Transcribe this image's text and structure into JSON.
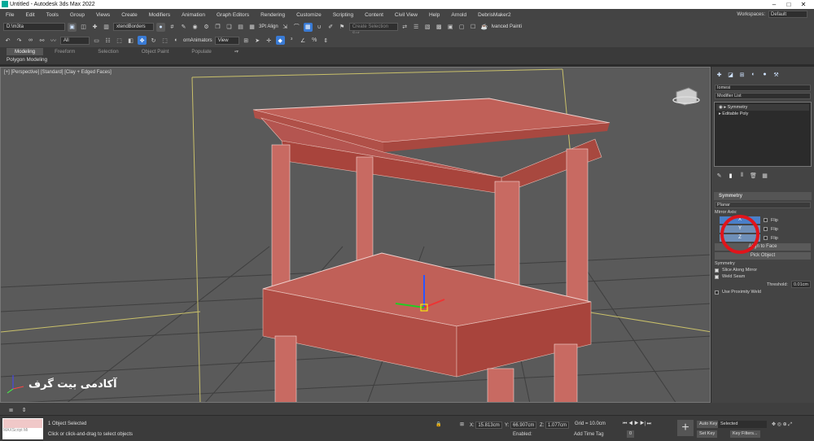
{
  "window": {
    "title": "Untitled - Autodesk 3ds Max 2022",
    "controls": [
      "–",
      "□",
      "✕"
    ]
  },
  "menu": [
    "File",
    "Edit",
    "Tools",
    "Group",
    "Views",
    "Create",
    "Modifiers",
    "Animation",
    "Graph Editors",
    "Rendering",
    "Customize",
    "Scripting",
    "Content",
    "Civil View",
    "Help",
    "Arnold",
    "DebrisMaker2"
  ],
  "workspaces": {
    "label": "Workspaces:",
    "value": "Default"
  },
  "toolbar1": {
    "path": "D:\\m3ta",
    "selection_label": "xtendBorders",
    "align": "3Pt Align",
    "snaps": "Create Selection Set",
    "advanced": "lvanced Painti"
  },
  "toolbar2": {
    "filter": "All",
    "animators": "ornAnimators",
    "view": "View"
  },
  "ribbon": {
    "tabs": [
      "Modeling",
      "Freeform",
      "Selection",
      "Object Paint",
      "Populate"
    ],
    "active": "Modeling",
    "sub": "Polygon Modeling"
  },
  "viewport": {
    "label": "[+] [Perspective] [Standard] [Clay + Edged Faces]",
    "watermark": "آکادمی بیت گرف"
  },
  "cmdpanel": {
    "object_name": "Iomesi",
    "modifier_list": "Modifier List",
    "stack": [
      "Symmetry",
      "Editable Poly"
    ],
    "rollout": "Symmetry",
    "mode": "Planar",
    "mirror_axis_label": "Mirror Axis:",
    "axes": [
      {
        "name": "X",
        "flip": "Flip"
      },
      {
        "name": "Y",
        "flip": "Flip"
      },
      {
        "name": "Z",
        "flip": "Flip"
      }
    ],
    "align_btn": "Align to Face",
    "pick_btn": "Pick Object",
    "sym_label": "Symmetry",
    "slice": "Slice Along Mirror",
    "weld": "Weld Seam",
    "threshold_label": "Threshold:",
    "threshold": "0.01cm",
    "prox": "Use Proximity Weld"
  },
  "status": {
    "maxscript": "MAXScript Mi",
    "selected": "1 Object Selected",
    "hint": "Click or click-and-drag to select objects",
    "x": "15.813cm",
    "y": "66.907cm",
    "z": "1.077cm",
    "grid": "Grid = 10.0cm",
    "enabled": "Enabled:",
    "addtime": "Add Time Tag",
    "autokey": "Auto Key",
    "setkey": "Set Key",
    "keyfilters": "Key Filters...",
    "selected_dd": "Selected",
    "frame": "0"
  }
}
